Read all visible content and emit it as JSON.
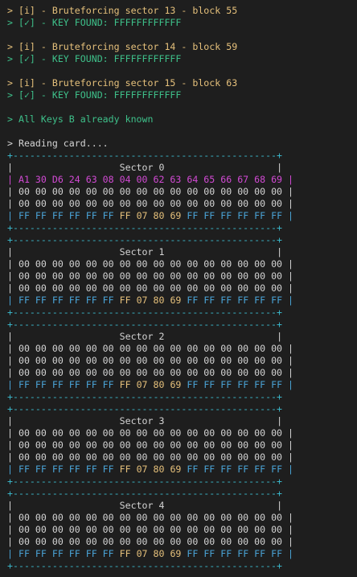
{
  "log": [
    {
      "prompt": ">",
      "text": "[i] - Bruteforcing sector 13 - block 55",
      "color": "yellow"
    },
    {
      "prompt": ">",
      "text": "[✓] - KEY FOUND: FFFFFFFFFFFF",
      "color": "green"
    },
    {
      "prompt": ">",
      "text": "[i] - Bruteforcing sector 14 - block 59",
      "color": "yellow"
    },
    {
      "prompt": ">",
      "text": "[✓] - KEY FOUND: FFFFFFFFFFFF",
      "color": "green"
    },
    {
      "prompt": ">",
      "text": "[i] - Bruteforcing sector 15 - block 63",
      "color": "yellow"
    },
    {
      "prompt": ">",
      "text": "[✓] - KEY FOUND: FFFFFFFFFFFF",
      "color": "green"
    },
    {
      "prompt": ">",
      "text": "All Keys B already known",
      "color": "green"
    },
    {
      "prompt": ">",
      "text": "Reading card....",
      "color": "white"
    }
  ],
  "border_line": "+-----------------------------------------------+",
  "sectors": [
    {
      "title": "Sector 0",
      "rows": [
        {
          "text": "A1 30 D6 24 63 08 04 00 62 63 64 65 66 67 68 69",
          "kind": "manufacturer"
        },
        {
          "text": "00 00 00 00 00 00 00 00 00 00 00 00 00 00 00 00",
          "kind": "data"
        },
        {
          "text": "00 00 00 00 00 00 00 00 00 00 00 00 00 00 00 00",
          "kind": "data"
        },
        {
          "text_keyA": "FF FF FF FF FF FF",
          "text_access": "FF 07 80 69",
          "text_keyB": "FF FF FF FF FF FF",
          "kind": "trailer"
        }
      ]
    },
    {
      "title": "Sector 1",
      "rows": [
        {
          "text": "00 00 00 00 00 00 00 00 00 00 00 00 00 00 00 00",
          "kind": "data"
        },
        {
          "text": "00 00 00 00 00 00 00 00 00 00 00 00 00 00 00 00",
          "kind": "data"
        },
        {
          "text": "00 00 00 00 00 00 00 00 00 00 00 00 00 00 00 00",
          "kind": "data"
        },
        {
          "text_keyA": "FF FF FF FF FF FF",
          "text_access": "FF 07 80 69",
          "text_keyB": "FF FF FF FF FF FF",
          "kind": "trailer"
        }
      ]
    },
    {
      "title": "Sector 2",
      "rows": [
        {
          "text": "00 00 00 00 00 00 00 00 00 00 00 00 00 00 00 00",
          "kind": "data"
        },
        {
          "text": "00 00 00 00 00 00 00 00 00 00 00 00 00 00 00 00",
          "kind": "data"
        },
        {
          "text": "00 00 00 00 00 00 00 00 00 00 00 00 00 00 00 00",
          "kind": "data"
        },
        {
          "text_keyA": "FF FF FF FF FF FF",
          "text_access": "FF 07 80 69",
          "text_keyB": "FF FF FF FF FF FF",
          "kind": "trailer"
        }
      ]
    },
    {
      "title": "Sector 3",
      "rows": [
        {
          "text": "00 00 00 00 00 00 00 00 00 00 00 00 00 00 00 00",
          "kind": "data"
        },
        {
          "text": "00 00 00 00 00 00 00 00 00 00 00 00 00 00 00 00",
          "kind": "data"
        },
        {
          "text": "00 00 00 00 00 00 00 00 00 00 00 00 00 00 00 00",
          "kind": "data"
        },
        {
          "text_keyA": "FF FF FF FF FF FF",
          "text_access": "FF 07 80 69",
          "text_keyB": "FF FF FF FF FF FF",
          "kind": "trailer"
        }
      ]
    },
    {
      "title": "Sector 4",
      "rows": [
        {
          "text": "00 00 00 00 00 00 00 00 00 00 00 00 00 00 00 00",
          "kind": "data"
        },
        {
          "text": "00 00 00 00 00 00 00 00 00 00 00 00 00 00 00 00",
          "kind": "data"
        },
        {
          "text": "00 00 00 00 00 00 00 00 00 00 00 00 00 00 00 00",
          "kind": "data"
        },
        {
          "text_keyA": "FF FF FF FF FF FF",
          "text_access": "FF 07 80 69",
          "text_keyB": "FF FF FF FF FF FF",
          "kind": "trailer"
        }
      ]
    }
  ],
  "colors": {
    "background": "#1e1e1e",
    "yellow": "#e5c07b",
    "green": "#3ec08a",
    "white": "#d4d4d4",
    "manufacturer": "#d24ad4",
    "keys": "#4aa3d6",
    "access_bits": "#e5c07b",
    "dash_border": "#3ab5c8"
  }
}
